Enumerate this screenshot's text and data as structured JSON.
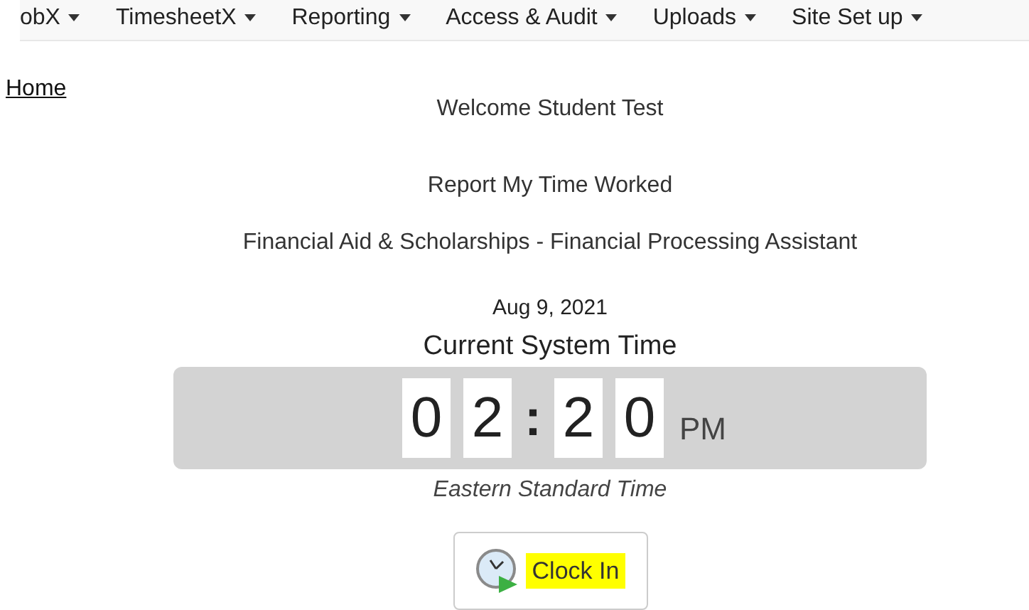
{
  "nav_menu": [
    {
      "label": "obX"
    },
    {
      "label": "TimesheetX"
    },
    {
      "label": "Reporting"
    },
    {
      "label": "Access & Audit"
    },
    {
      "label": "Uploads"
    },
    {
      "label": "Site Set up"
    }
  ],
  "breadcrumb": "Home",
  "welcome": "Welcome Student Test",
  "heading": "Report My Time Worked",
  "position": "Financial Aid & Scholarships - Financial Processing Assistant",
  "date": "Aug 9, 2021",
  "clock_title": "Current System Time",
  "clock": {
    "cells": [
      {
        "kind": "digit",
        "text": "0"
      },
      {
        "kind": "digit",
        "text": "2"
      },
      {
        "kind": "separator",
        "text": ":"
      },
      {
        "kind": "digit",
        "text": "2"
      },
      {
        "kind": "digit",
        "text": "0"
      }
    ],
    "period": "PM"
  },
  "timezone": "Eastern Standard Time",
  "clock_in_button": {
    "label": "Clock In",
    "highlighted": true
  }
}
